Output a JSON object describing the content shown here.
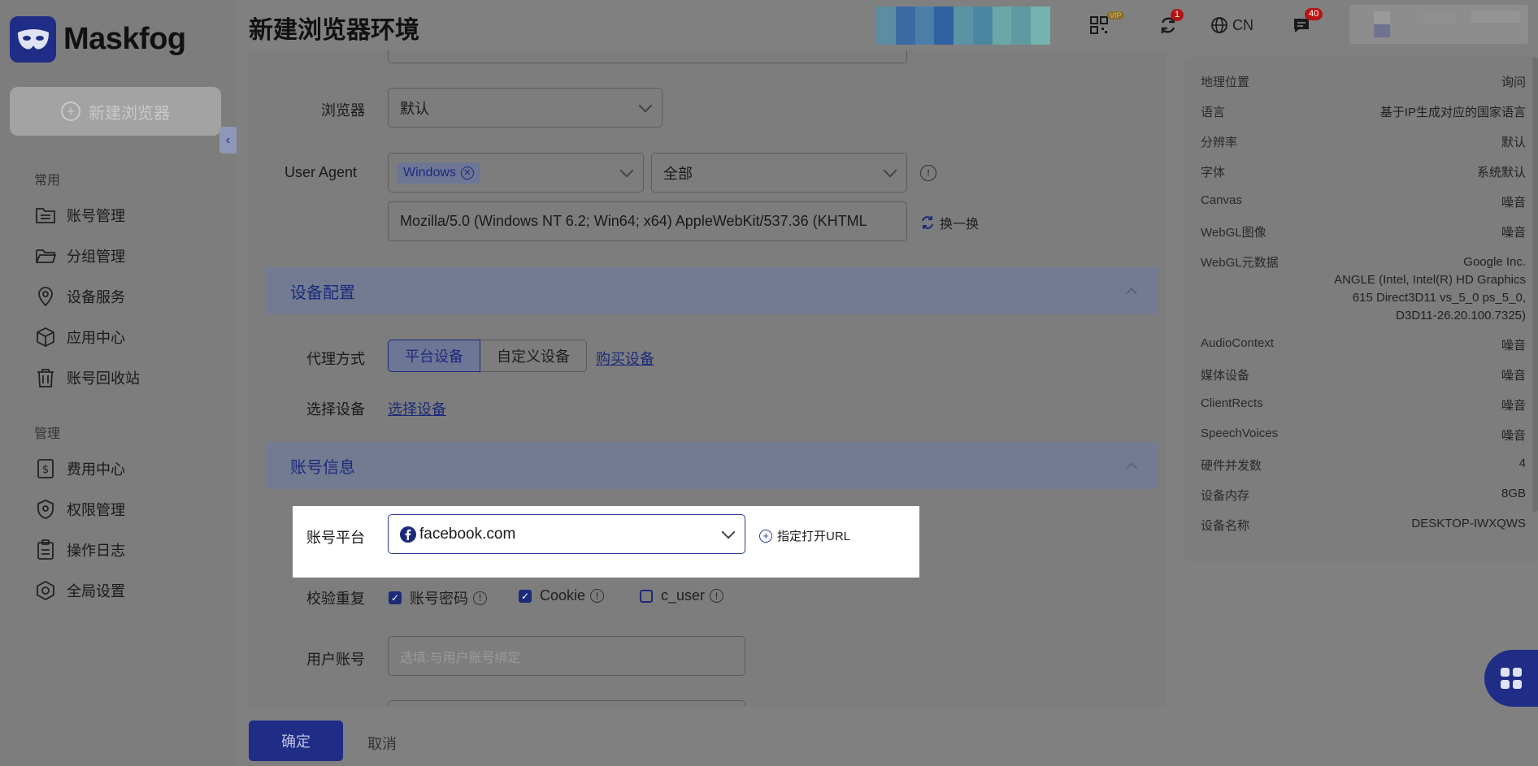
{
  "app": {
    "name": "Maskfog"
  },
  "sidebar": {
    "new_button_label": "新建浏览器",
    "section_common": "常用",
    "section_manage": "管理",
    "items": [
      {
        "label": "账号管理",
        "icon": "folder-list-icon"
      },
      {
        "label": "分组管理",
        "icon": "folder-open-icon"
      },
      {
        "label": "设备服务",
        "icon": "location-pin-icon"
      },
      {
        "label": "应用中心",
        "icon": "cube-icon"
      },
      {
        "label": "账号回收站",
        "icon": "trash-icon"
      },
      {
        "label": "费用中心",
        "icon": "dollar-doc-icon"
      },
      {
        "label": "权限管理",
        "icon": "shield-icon"
      },
      {
        "label": "操作日志",
        "icon": "clipboard-icon"
      },
      {
        "label": "全局设置",
        "icon": "hexagon-gear-icon"
      }
    ]
  },
  "header": {
    "title": "新建浏览器环境",
    "vip_label": "VIP",
    "sync_badge": "1",
    "language": "CN",
    "message_badge": "40"
  },
  "form": {
    "browser_label": "浏览器",
    "browser_value": "默认",
    "ua_label": "User Agent",
    "ua_os_tag": "Windows",
    "ua_scope": "全部",
    "ua_string": "Mozilla/5.0 (Windows NT 6.2; Win64; x64) AppleWebKit/537.36 (KHTML",
    "ua_refresh": "换一换",
    "device_section": "设备配置",
    "proxy_label": "代理方式",
    "proxy_options": [
      "平台设备",
      "自定义设备"
    ],
    "proxy_buy": "购买设备",
    "select_device_label": "选择设备",
    "select_device_link": "选择设备",
    "account_section": "账号信息",
    "platform_label": "账号平台",
    "platform_value": "facebook.com",
    "open_url": "指定打开URL",
    "dedupe_label": "校验重复",
    "dedupe_options": [
      {
        "label": "账号密码",
        "checked": true
      },
      {
        "label": "Cookie",
        "checked": true
      },
      {
        "label": "c_user",
        "checked": false
      }
    ],
    "user_account_label": "用户账号",
    "user_account_placeholder": "选填:与用户账号绑定"
  },
  "footer": {
    "confirm": "确定",
    "cancel": "取消"
  },
  "fingerprint": [
    {
      "k": "地理位置",
      "v": "询问"
    },
    {
      "k": "语言",
      "v": "基于IP生成对应的国家语言"
    },
    {
      "k": "分辨率",
      "v": "默认"
    },
    {
      "k": "字体",
      "v": "系统默认"
    },
    {
      "k": "Canvas",
      "v": "噪音"
    },
    {
      "k": "WebGL图像",
      "v": "噪音"
    },
    {
      "k": "WebGL元数据",
      "v": "Google Inc.",
      "v2": "ANGLE (Intel, Intel(R) HD Graphics",
      "v3": "615 Direct3D11 vs_5_0 ps_5_0,",
      "v4": "D3D11-26.20.100.7325)"
    },
    {
      "k": "AudioContext",
      "v": "噪音"
    },
    {
      "k": "媒体设备",
      "v": "噪音"
    },
    {
      "k": "ClientRects",
      "v": "噪音"
    },
    {
      "k": "SpeechVoices",
      "v": "噪音"
    },
    {
      "k": "硬件并发数",
      "v": "4"
    },
    {
      "k": "设备内存",
      "v": "8GB"
    },
    {
      "k": "设备名称",
      "v": "DESKTOP-IWXQWS"
    }
  ],
  "colors": {
    "brand": "#1f2d87",
    "overlay_bg": "#808080",
    "highlight": "#ffffff",
    "badge": "#b31515"
  }
}
